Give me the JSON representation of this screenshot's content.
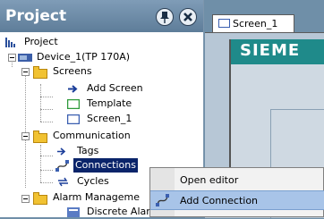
{
  "project_pane": {
    "title": "Project",
    "tree": [
      {
        "label": "Project",
        "icon": "project-icon"
      },
      {
        "label": "Device_1(TP 170A)",
        "icon": "device-icon"
      },
      {
        "label": "Screens",
        "icon": "folder-icon"
      },
      {
        "label": "Add Screen",
        "icon": "add-screen-icon"
      },
      {
        "label": "Template",
        "icon": "template-icon"
      },
      {
        "label": "Screen_1",
        "icon": "screen-icon"
      },
      {
        "label": "Communication",
        "icon": "folder-icon"
      },
      {
        "label": "Tags",
        "icon": "tags-icon"
      },
      {
        "label": "Connections",
        "icon": "connections-icon"
      },
      {
        "label": "Cycles",
        "icon": "cycles-icon"
      },
      {
        "label": "Alarm Manageme",
        "icon": "folder-icon"
      },
      {
        "label": "Discrete Alar",
        "icon": "discrete-alarm-icon"
      }
    ]
  },
  "editor": {
    "tab_label": "Screen_1",
    "brand": "SIEME"
  },
  "context_menu": {
    "items": [
      {
        "label": "Open editor"
      },
      {
        "label": "Add Connection"
      }
    ]
  },
  "colors": {
    "header": "#6b8aa6",
    "selection": "#0a246a",
    "menu_highlight": "#a8c4e8",
    "hmi_header": "#1f8a8a"
  }
}
